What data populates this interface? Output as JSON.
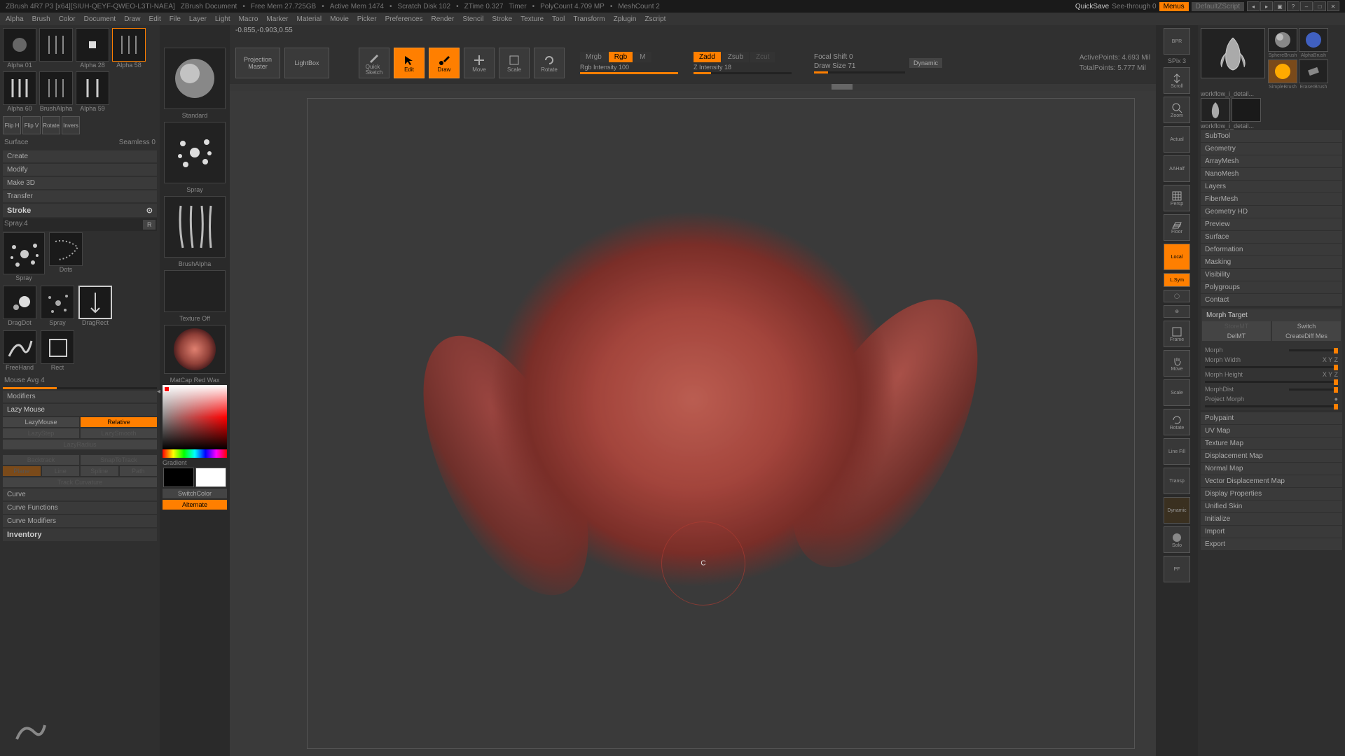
{
  "titlebar": {
    "app": "ZBrush 4R7 P3 [x64][SIUH-QEYF-QWEO-L3TI-NAEA]",
    "doc": "ZBrush Document",
    "freemem": "Free Mem 27.725GB",
    "activemem": "Active Mem 1474",
    "scratch": "Scratch Disk 102",
    "ztime": "ZTime 0.327",
    "timer": "Timer",
    "polycount": "PolyCount 4.709 MP",
    "meshcount": "MeshCount 2",
    "quicksave": "QuickSave",
    "seethrough": "See-through  0",
    "menus": "Menus",
    "defaultscript": "DefaultZScript"
  },
  "menubar": [
    "Alpha",
    "Brush",
    "Color",
    "Document",
    "Draw",
    "Edit",
    "File",
    "Layer",
    "Light",
    "Macro",
    "Marker",
    "Material",
    "Movie",
    "Picker",
    "Preferences",
    "Render",
    "Stencil",
    "Stroke",
    "Texture",
    "Tool",
    "Transform",
    "Zplugin",
    "Zscript"
  ],
  "coords": "-0.855,-0.903,0.55",
  "alphas": [
    {
      "label": "Alpha 01"
    },
    {
      "label": ""
    },
    {
      "label": "Alpha 28"
    },
    {
      "label": "Alpha 58"
    },
    {
      "label": "Alpha 60"
    },
    {
      "label": "BrushAlpha"
    },
    {
      "label": "Alpha 59"
    },
    {
      "label": ""
    }
  ],
  "alpha_btns": [
    "Flip H",
    "Flip V",
    "Rotate",
    "Invers"
  ],
  "surface_label": "Surface",
  "seamless": "Seamless 0",
  "alpha_actions": [
    "Create",
    "Modify",
    "Make 3D",
    "Transfer"
  ],
  "stroke": {
    "header": "Stroke",
    "current": "Spray.4",
    "r": "R",
    "mouseavg": "Mouse Avg 4",
    "options": [
      "Spray",
      "Dots",
      "DragDot",
      "Spray",
      "FreeHand",
      "Rect",
      "DragRect"
    ],
    "modifiers": "Modifiers",
    "lazymouse": "Lazy Mouse",
    "lazymouse_btn": "LazyMouse",
    "relative": "Relative",
    "lazystep": "LazyStep",
    "lazysmooth": "LazySmooth",
    "lazyradius": "LazyRadius",
    "backtrack": "Backtrack",
    "snaptotrack": "SnapToTrack",
    "trackmodes": [
      "Plane",
      "Line",
      "Spline",
      "Path"
    ],
    "trackcurv": "Track Curvature",
    "curve": "Curve",
    "curvefunc": "Curve Functions",
    "curvemod": "Curve Modifiers",
    "inventory": "Inventory"
  },
  "centercol": {
    "brush": "Standard",
    "stroke": "Spray",
    "alpha": "BrushAlpha",
    "texture": "Texture Off",
    "material": "MatCap Red Wax",
    "gradient": "Gradient",
    "switchcolor": "SwitchColor",
    "alternate": "Alternate"
  },
  "toolbar": {
    "projection": "Projection\nMaster",
    "lightbox": "LightBox",
    "quicksketch": "Quick\nSketch",
    "edit": "Edit",
    "draw": "Draw",
    "move": "Move",
    "scale": "Scale",
    "rotate": "Rotate",
    "mrgb": "Mrgb",
    "rgb": "Rgb",
    "m": "M",
    "rgbint": "Rgb Intensity 100",
    "zadd": "Zadd",
    "zsub": "Zsub",
    "zcut": "Zcut",
    "zint": "Z Intensity 18",
    "focal": "Focal Shift 0",
    "drawsize": "Draw Size 71",
    "dynamic": "Dynamic",
    "activepoints": "ActivePoints: 4.693 Mil",
    "totalpoints": "TotalPoints: 5.777 Mil"
  },
  "rail": {
    "bpr": "BPR",
    "spx": "SPix 3",
    "scroll": "Scroll",
    "zoom": "Zoom",
    "actual": "Actual",
    "aahalf": "AAHalf",
    "persp": "Persp",
    "floor": "Floor",
    "local": "Local",
    "xyz": "L.Sym",
    "lock": "",
    "frame": "Frame",
    "move": "Move",
    "scale": "Scale",
    "rotate": "Rotate",
    "linefill": "Line Fill",
    "transp": "Transp",
    "dynamic": "Dynamic",
    "solo": "Solo",
    "pf": "PF"
  },
  "tools": {
    "items": [
      "SphereBrush",
      "AlphaBrush",
      "SimpleBrush",
      "EraserBrush"
    ],
    "currentfile": "workflow_i_detail..."
  },
  "rightpanel": {
    "sections": [
      "SubTool",
      "Geometry",
      "ArrayMesh",
      "NanoMesh",
      "Layers",
      "FiberMesh",
      "Geometry HD",
      "Preview",
      "Surface",
      "Deformation",
      "Masking",
      "Visibility",
      "Polygroups",
      "Contact"
    ],
    "morph_target": "Morph Target",
    "storemt": "StoreMT",
    "switch": "Switch",
    "delmt": "DelMT",
    "creatediff": "CreateDiff Mes",
    "morph": "Morph",
    "morphw": "Morph Width",
    "morphh": "Morph Height",
    "morphd": "MorphDist",
    "projmorph": "Project Morph",
    "xyzval": "X Y Z",
    "sections2": [
      "Polypaint",
      "UV Map",
      "Texture Map",
      "Displacement Map",
      "Normal Map",
      "Vector Displacement Map",
      "Display Properties",
      "Unified Skin",
      "Initialize",
      "Import",
      "Export"
    ]
  }
}
